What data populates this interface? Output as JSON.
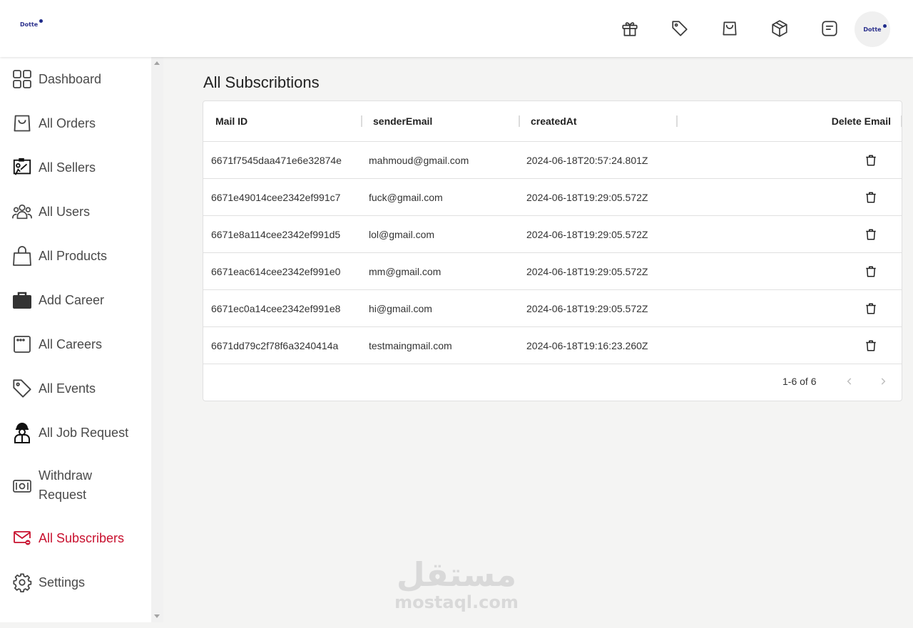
{
  "brand": {
    "logo_text": "Dotte",
    "accent": "#c8102e",
    "logo_color": "#2a2f8c"
  },
  "topbar": {
    "icons": [
      "gift-icon",
      "tag-icon",
      "shopping-bag-icon",
      "package-icon",
      "note-icon"
    ],
    "avatar_text": "Dotte"
  },
  "sidebar": {
    "items": [
      {
        "label": "Dashboard",
        "icon": "dashboard-icon"
      },
      {
        "label": "All Orders",
        "icon": "shopping-bag-icon"
      },
      {
        "label": "All Sellers",
        "icon": "sellers-icon"
      },
      {
        "label": "All Users",
        "icon": "users-icon"
      },
      {
        "label": "All Products",
        "icon": "handbag-icon"
      },
      {
        "label": "Add Career",
        "icon": "briefcase-icon"
      },
      {
        "label": "All Careers",
        "icon": "window-icon"
      },
      {
        "label": "All Events",
        "icon": "tag-icon"
      },
      {
        "label": "All Job Request",
        "icon": "worker-icon"
      },
      {
        "label": "Withdraw",
        "label2": "Request",
        "icon": "cash-icon"
      },
      {
        "label": "All Subscribers",
        "icon": "mail-icon",
        "active": true
      },
      {
        "label": "Settings",
        "icon": "gear-icon"
      }
    ]
  },
  "main": {
    "title": "All Subscribtions",
    "columns": [
      "Mail ID",
      "senderEmail",
      "createdAt",
      "Delete Email"
    ],
    "rows": [
      {
        "id": "6671f7545daa471e6e32874e",
        "email": "mahmoud@gmail.com",
        "created": "2024-06-18T20:57:24.801Z"
      },
      {
        "id": "6671e49014cee2342ef991c7",
        "email": "fuck@gmail.com",
        "created": "2024-06-18T19:29:05.572Z"
      },
      {
        "id": "6671e8a114cee2342ef991d5",
        "email": "lol@gmail.com",
        "created": "2024-06-18T19:29:05.572Z"
      },
      {
        "id": "6671eac614cee2342ef991e0",
        "email": "mm@gmail.com",
        "created": "2024-06-18T19:29:05.572Z"
      },
      {
        "id": "6671ec0a14cee2342ef991e8",
        "email": "hi@gmail.com",
        "created": "2024-06-18T19:29:05.572Z"
      },
      {
        "id": "6671dd79c2f78f6a3240414a",
        "email": "testmaingmail.com",
        "created": "2024-06-18T19:16:23.260Z"
      }
    ],
    "pagination": "1-6 of 6"
  },
  "watermark": {
    "arabic": "مستقل",
    "latin": "mostaql.com"
  }
}
